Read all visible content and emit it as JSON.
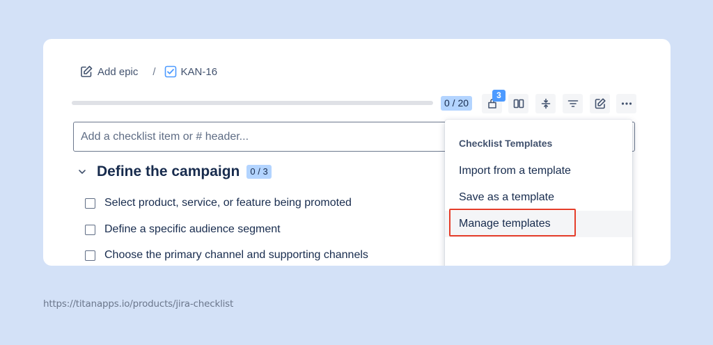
{
  "breadcrumb": {
    "add_epic_label": "Add epic",
    "separator": "/",
    "issue_key": "KAN-16",
    "add_epic_icon": "edit-square-icon",
    "issue_icon": "checkbox-issue-icon"
  },
  "progress": {
    "completed": 0,
    "total": 20,
    "fraction": 0.0,
    "label": "0 / 20"
  },
  "toolbar": {
    "notifications_count": "3",
    "buttons": [
      "notification-icon",
      "columns-icon",
      "collapse-icon",
      "filter-icon",
      "edit-icon",
      "more-icon"
    ]
  },
  "add_item": {
    "placeholder": "Add a checklist item or # header...",
    "value": ""
  },
  "section": {
    "title": "Define the campaign",
    "badge": "0 / 3",
    "items": [
      {
        "label": "Select product, service, or feature being promoted",
        "checked": false
      },
      {
        "label": "Define a specific audience segment",
        "checked": false
      },
      {
        "label": "Choose the primary channel and supporting channels",
        "checked": false
      }
    ]
  },
  "dropdown": {
    "heading": "Checklist Templates",
    "items": [
      {
        "label": "Import from a template"
      },
      {
        "label": "Save as a template"
      },
      {
        "label": "Manage templates"
      }
    ]
  },
  "colors": {
    "background": "#d3e1f7",
    "accent": "#4c9aff",
    "badge": "#b3d4ff",
    "highlight": "#e53d2a"
  },
  "footer": {
    "source_url": "https://titanapps.io/products/jira-checklist"
  }
}
